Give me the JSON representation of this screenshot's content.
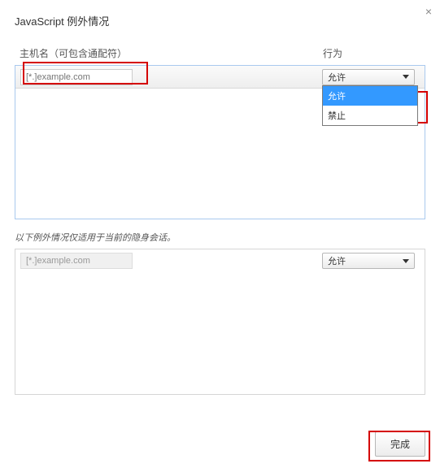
{
  "dialog": {
    "title": "JavaScript 例外情况",
    "close_label": "×"
  },
  "columns": {
    "host": "主机名（可包含通配符）",
    "action": "行为"
  },
  "main_row": {
    "host_placeholder": "[*.]example.com",
    "selected_action": "允许"
  },
  "dropdown_options": {
    "allow": "允许",
    "block": "禁止"
  },
  "incognito_note": "以下例外情况仅适用于当前的隐身会话。",
  "incognito_row": {
    "host_placeholder": "[*.]example.com",
    "selected_action": "允许"
  },
  "footer": {
    "done": "完成"
  }
}
